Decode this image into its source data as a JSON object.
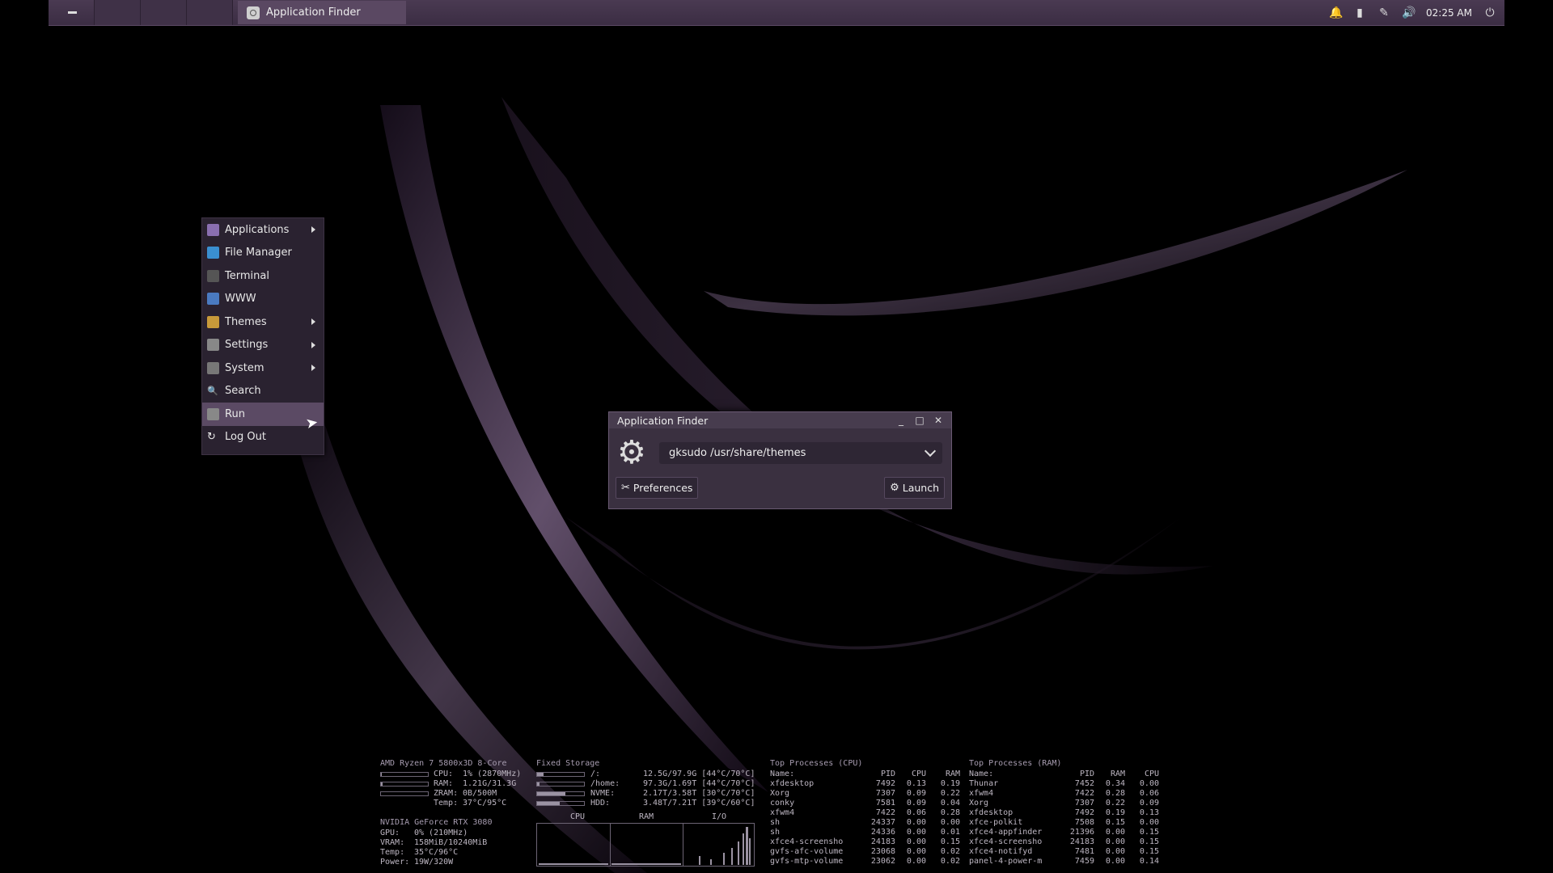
{
  "panel": {
    "task_title": "Application Finder",
    "clock": "02:25 AM",
    "tray_icons": [
      "bell-icon",
      "battery-icon",
      "pen-icon",
      "volume-icon",
      "power-icon"
    ]
  },
  "menu": {
    "items": [
      {
        "label": "Applications",
        "icon": "applications-icon",
        "color": "#8a6fb0",
        "submenu": true
      },
      {
        "label": "File Manager",
        "icon": "file-manager-icon",
        "color": "#3a8fd0",
        "submenu": false
      },
      {
        "label": "Terminal",
        "icon": "terminal-icon",
        "color": "#555555",
        "submenu": false
      },
      {
        "label": "WWW",
        "icon": "www-icon",
        "color": "#4a7ac0",
        "submenu": false
      },
      {
        "label": "Themes",
        "icon": "themes-icon",
        "color": "#c89a3a",
        "submenu": true
      },
      {
        "label": "Settings",
        "icon": "settings-icon",
        "color": "#888888",
        "submenu": true
      },
      {
        "label": "System",
        "icon": "system-icon",
        "color": "#777777",
        "submenu": true
      },
      {
        "label": "Search",
        "icon": "search-icon",
        "color": "transparent",
        "submenu": false
      },
      {
        "label": "Run",
        "icon": "run-icon",
        "color": "#888888",
        "submenu": false,
        "active": true
      },
      {
        "label": "Log Out",
        "icon": "logout-icon",
        "color": "transparent",
        "submenu": false
      }
    ]
  },
  "finder": {
    "title": "Application Finder",
    "command": "gksudo /usr/share/themes",
    "preferences_label": "Preferences",
    "launch_label": "Launch"
  },
  "conky": {
    "cpu": {
      "header": "AMD Ryzen 7 5800x3D 8-Core",
      "rows": [
        {
          "label": "CPU:",
          "value": "1% (2870MHz)",
          "level": 0.01
        },
        {
          "label": "RAM:",
          "value": "1.21G/31.3G",
          "level": 0.04
        },
        {
          "label": "ZRAM:",
          "value": "0B/500M",
          "level": 0.0
        },
        {
          "label": "Temp:",
          "value": "37°C/95°C",
          "level": null
        }
      ]
    },
    "gpu": {
      "header": "NVIDIA GeForce RTX 3080",
      "rows": [
        {
          "label": "GPU:",
          "value": "0% (210MHz)"
        },
        {
          "label": "VRAM:",
          "value": "158MiB/10240MiB"
        },
        {
          "label": "Temp:",
          "value": "35°C/96°C"
        },
        {
          "label": "Power:",
          "value": "19W/320W"
        }
      ]
    },
    "storage": {
      "header": "Fixed Storage",
      "rows": [
        {
          "mount": "/:",
          "value": "12.5G/97.9G [44°C/70°C]",
          "level": 0.13
        },
        {
          "mount": "/home:",
          "value": "97.3G/1.69T [44°C/70°C]",
          "level": 0.06
        },
        {
          "mount": "NVME:",
          "value": "2.17T/3.58T [30°C/70°C]",
          "level": 0.61
        },
        {
          "mount": "HDD:",
          "value": "3.48T/7.21T [39°C/60°C]",
          "level": 0.48
        }
      ],
      "graph_labels": [
        "CPU",
        "RAM",
        "I/O"
      ]
    },
    "top_cpu": {
      "header": "Top Processes (CPU)",
      "columns": [
        "Name:",
        "PID",
        "CPU",
        "RAM"
      ],
      "rows": [
        [
          "xfdesktop",
          "7492",
          "0.13",
          "0.19"
        ],
        [
          "Xorg",
          "7307",
          "0.09",
          "0.22"
        ],
        [
          "conky",
          "7581",
          "0.09",
          "0.04"
        ],
        [
          "xfwm4",
          "7422",
          "0.06",
          "0.28"
        ],
        [
          "sh",
          "24337",
          "0.00",
          "0.00"
        ],
        [
          "sh",
          "24336",
          "0.00",
          "0.01"
        ],
        [
          "xfce4-screensho",
          "24183",
          "0.00",
          "0.15"
        ],
        [
          "gvfs-afc-volume",
          "23068",
          "0.00",
          "0.02"
        ],
        [
          "gvfs-mtp-volume",
          "23062",
          "0.00",
          "0.02"
        ]
      ]
    },
    "top_ram": {
      "header": "Top Processes (RAM)",
      "columns": [
        "Name:",
        "PID",
        "RAM",
        "CPU"
      ],
      "rows": [
        [
          "Thunar",
          "7452",
          "0.34",
          "0.00"
        ],
        [
          "xfwm4",
          "7422",
          "0.28",
          "0.06"
        ],
        [
          "Xorg",
          "7307",
          "0.22",
          "0.09"
        ],
        [
          "xfdesktop",
          "7492",
          "0.19",
          "0.13"
        ],
        [
          "xfce-polkit",
          "7508",
          "0.15",
          "0.00"
        ],
        [
          "xfce4-appfinder",
          "21396",
          "0.00",
          "0.15"
        ],
        [
          "xfce4-screensho",
          "24183",
          "0.00",
          "0.15"
        ],
        [
          "xfce4-notifyd",
          "7481",
          "0.00",
          "0.15"
        ],
        [
          "panel-4-power-m",
          "7459",
          "0.00",
          "0.14"
        ]
      ]
    }
  }
}
